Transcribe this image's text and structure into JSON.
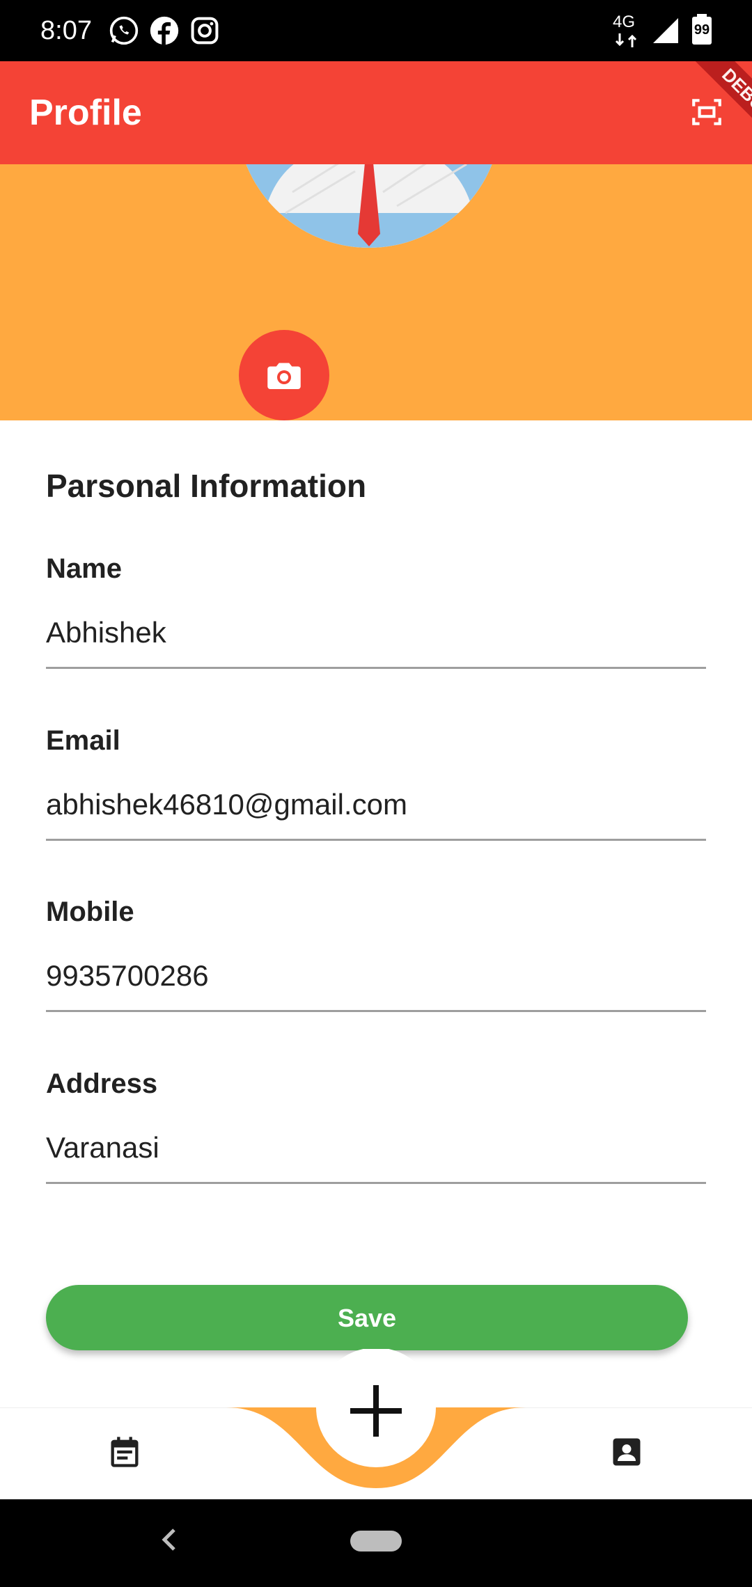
{
  "status_bar": {
    "time": "8:07",
    "network": "4G",
    "battery": "99",
    "app_icons": [
      "whatsapp-icon",
      "facebook-icon",
      "instagram-icon"
    ]
  },
  "app_bar": {
    "title": "Profile",
    "debug_label": "DEBUG",
    "color": "#f44336"
  },
  "header": {
    "color": "#ffa940"
  },
  "form": {
    "section_title": "Parsonal Information",
    "fields": [
      {
        "label": "Name",
        "value": "Abhishek"
      },
      {
        "label": "Email",
        "value": "abhishek46810@gmail.com"
      },
      {
        "label": "Mobile",
        "value": "9935700286"
      },
      {
        "label": "Address",
        "value": "Varanasi"
      }
    ]
  },
  "actions": {
    "save_label": "Save",
    "save_color": "#4caf50"
  },
  "bottom_nav": {
    "left_icon": "calendar-icon",
    "center_icon": "plus-icon",
    "right_icon": "contact-icon",
    "accent": "#ffa940"
  }
}
